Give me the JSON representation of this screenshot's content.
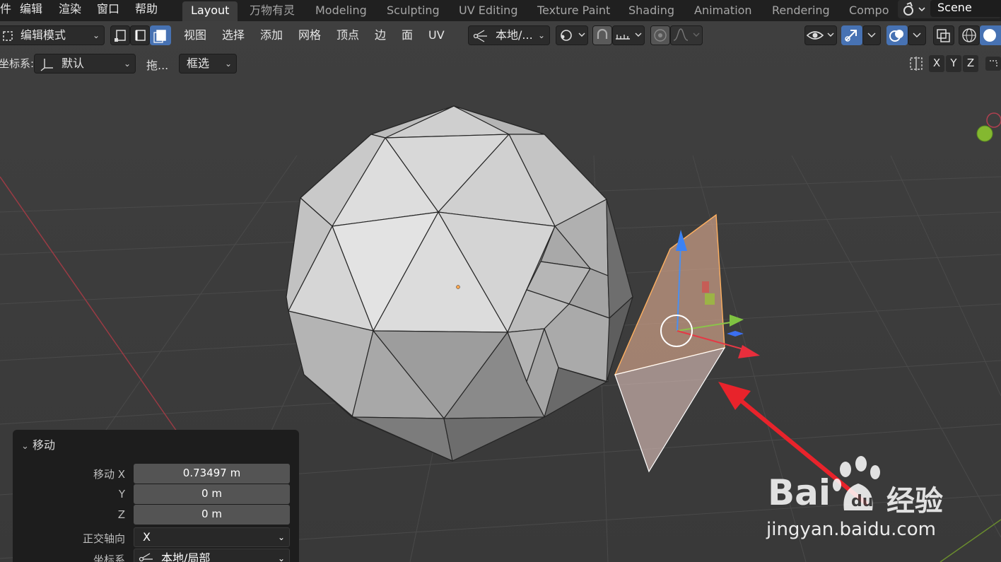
{
  "menubar": {
    "items": [
      "件",
      "编辑",
      "渲染",
      "窗口",
      "帮助"
    ]
  },
  "workspaces": {
    "tabs": [
      "Layout",
      "万物有灵",
      "Modeling",
      "Sculpting",
      "UV Editing",
      "Texture Paint",
      "Shading",
      "Animation",
      "Rendering",
      "Compo"
    ],
    "active": "Layout"
  },
  "scene": {
    "label": "Scene"
  },
  "header": {
    "mode": "编辑模式",
    "menus": [
      "视图",
      "选择",
      "添加",
      "网格",
      "顶点",
      "边",
      "面",
      "UV"
    ],
    "transform_orientation": "本地/...",
    "coord_label": "坐标系:",
    "coord_value": "默认",
    "drag_label": "拖...",
    "select_mode": "框选",
    "axes": [
      "X",
      "Y",
      "Z"
    ]
  },
  "operator_panel": {
    "title": "移动",
    "rows": [
      {
        "label": "移动 X",
        "value": "0.73497 m"
      },
      {
        "label": "Y",
        "value": "0 m"
      },
      {
        "label": "Z",
        "value": "0 m"
      }
    ],
    "constraint_axis_label": "正交轴向",
    "constraint_axis_value": "X",
    "orientation_label": "坐标系",
    "orientation_value": "本地/局部"
  },
  "watermark": {
    "brand_left": "Bai",
    "brand_right": "经验",
    "url": "jingyan.baidu.com"
  },
  "colors": {
    "accent": "#4772b3",
    "selection": "#ffa64d",
    "arrow": "#e8232b"
  }
}
